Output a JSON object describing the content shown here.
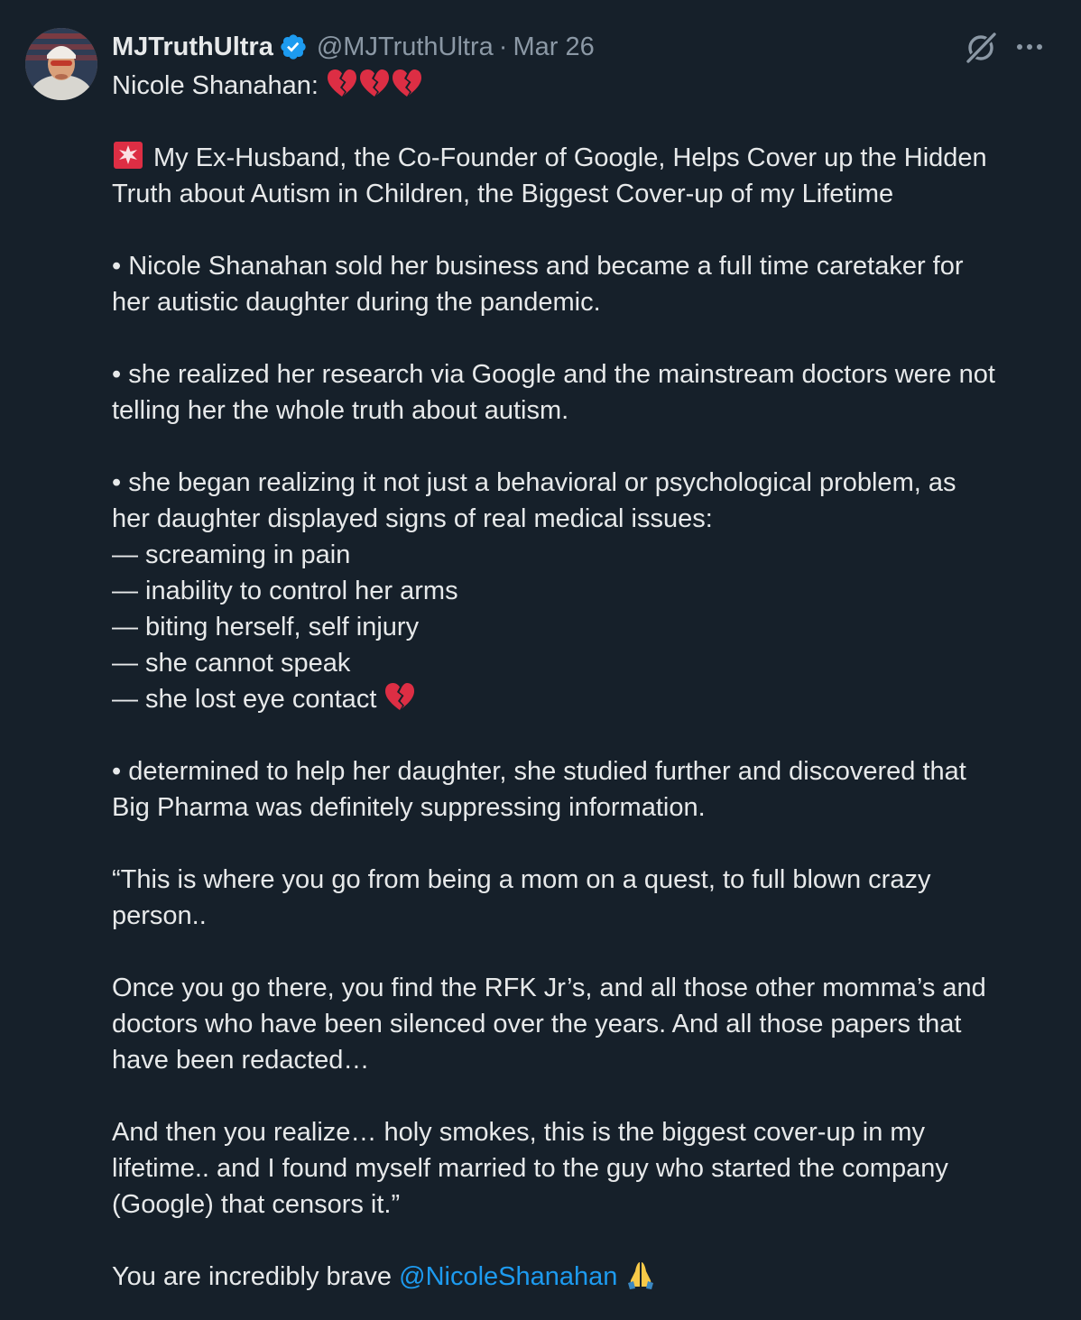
{
  "user": {
    "display_name": "MJTruthUltra",
    "handle": "@MJTruthUltra",
    "separator": "·",
    "date": "Mar 26",
    "verified": true
  },
  "actions": {
    "grok_icon": "grok-icon",
    "more_icon": "more-icon"
  },
  "post": {
    "line_1": "Nicole Shanahan: ",
    "line_2": "My Ex-Husband, the Co-Founder of Google, Helps Cover up the Hidden",
    "line_3": "Truth about Autism in Children, the Biggest Cover-up of my Lifetime",
    "line_4": "• Nicole Shanahan sold her business and became a full time caretaker for",
    "line_5": "her autistic daughter during the pandemic.",
    "line_6": "• she realized her research via Google and the mainstream doctors were not",
    "line_7": "telling her the whole truth about autism.",
    "line_8": "• she began realizing it not just a behavioral or psychological problem, as",
    "line_9": "her daughter displayed signs of real medical issues:",
    "line_10": "— screaming in pain",
    "line_11": "— inability to control her arms",
    "line_12": "— biting herself, self injury",
    "line_13": "— she cannot speak",
    "line_14": "— she lost eye contact ",
    "line_15": "• determined to help her daughter, she studied further and discovered that",
    "line_16": "Big Pharma was definitely suppressing information.",
    "line_17": "“This is where you go from being a mom on a quest, to full blown crazy",
    "line_18": "person..",
    "line_19": "Once you go there, you find the RFK Jr’s, and all those other momma’s and",
    "line_20": "doctors who have been silenced over the years. And all those papers that",
    "line_21": "have been redacted…",
    "line_22": "And then you realize… holy smokes, this is the biggest cover-up in my",
    "line_23": "lifetime.. and I found myself married to the guy who started the company",
    "line_24": "(Google) that censors it.”",
    "line_25": "You are incredibly brave ",
    "mention": "@NicoleShanahan",
    "emoji": {
      "broken_heart": "broken-heart-emoji",
      "siren": "police-light-emoji",
      "folded_hands": "folded-hands-emoji"
    }
  },
  "colors": {
    "background": "#16202a",
    "text": "#e7e9ea",
    "muted": "#8b98a5",
    "link": "#1d9bf0",
    "verified": "#1d9bf0"
  }
}
